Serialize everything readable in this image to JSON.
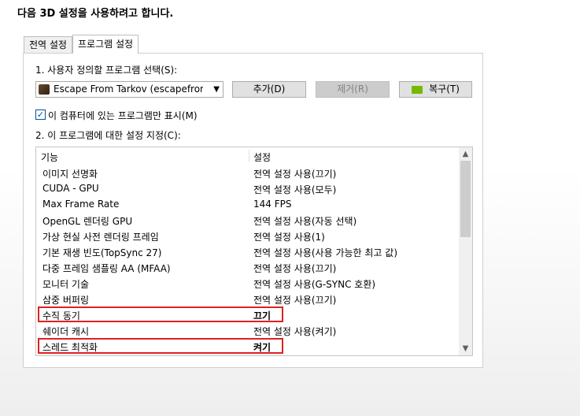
{
  "heading": "다음 3D 설정을 사용하려고 합니다.",
  "tabs": [
    {
      "label": "전역 설정",
      "active": false
    },
    {
      "label": "프로그램 설정",
      "active": true
    }
  ],
  "section1_label": "1. 사용자 정의할 프로그램 선택(S):",
  "program_select": {
    "value": "Escape From Tarkov (escapefromta...",
    "icon": "app-icon"
  },
  "buttons": {
    "add": "추가(D)",
    "remove": "제거(R)",
    "restore": "복구(T)"
  },
  "show_only_checkbox": {
    "label": "이 컴퓨터에 있는 프로그램만 표시(M)",
    "checked": true
  },
  "section2_label": "2. 이 프로그램에 대한 설정 지정(C):",
  "table": {
    "headers": [
      "기능",
      "설정"
    ],
    "rows": [
      {
        "feature": "이미지 선명화",
        "setting": "전역 설정 사용(끄기)",
        "highlight": false
      },
      {
        "feature": "CUDA - GPU",
        "setting": "전역 설정 사용(모두)",
        "highlight": false
      },
      {
        "feature": "Max Frame Rate",
        "setting": "144 FPS",
        "highlight": false
      },
      {
        "feature": "OpenGL 렌더링 GPU",
        "setting": "전역 설정 사용(자동 선택)",
        "highlight": false
      },
      {
        "feature": "가상 현실 사전 렌더링 프레임",
        "setting": "전역 설정 사용(1)",
        "highlight": false
      },
      {
        "feature": "기본 재생 빈도(TopSync 27)",
        "setting": "전역 설정 사용(사용 가능한 최고 값)",
        "highlight": false
      },
      {
        "feature": "다중 프레임 샘플링 AA (MFAA)",
        "setting": "전역 설정 사용(끄기)",
        "highlight": false
      },
      {
        "feature": "모니터 기술",
        "setting": "전역 설정 사용(G-SYNC 호환)",
        "highlight": false
      },
      {
        "feature": "삼중 버퍼링",
        "setting": "전역 설정 사용(끄기)",
        "highlight": false
      },
      {
        "feature": "수직 동기",
        "setting": "끄기",
        "highlight": true
      },
      {
        "feature": "쉐이더 캐시",
        "setting": "전역 설정 사용(켜기)",
        "highlight": false
      },
      {
        "feature": "스레드 최적화",
        "setting": "켜기",
        "highlight": true
      }
    ]
  },
  "colors": {
    "highlight_border": "#e02020",
    "nvidia_green": "#76b900",
    "checkbox_accent": "#005499"
  }
}
